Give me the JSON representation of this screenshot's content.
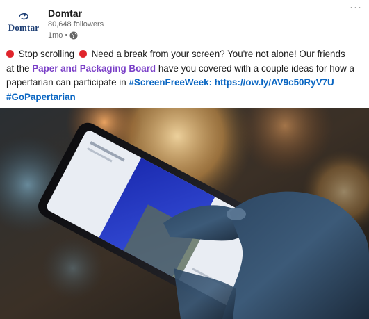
{
  "author": {
    "logo_text": "Domtar",
    "name": "Domtar",
    "followers": "80,648 followers",
    "time": "1mo",
    "separator": "•"
  },
  "menu": {
    "icon": "more-horizontal-icon",
    "glyph": "···"
  },
  "post": {
    "line1": {
      "emoji1": "red-circle",
      "t1": "Stop scrolling",
      "emoji2": "red-circle",
      "t2": "Need a break from your screen? You're not alone! Our friends"
    },
    "line2": {
      "t1": "at the",
      "mention": "Paper and Packaging Board",
      "t2": "have you covered with a couple ideas for how a"
    },
    "line3": {
      "t1": "papertarian can participate in",
      "hashtag": "#ScreenFreeWeek:",
      "link": "https://ow.ly/AV9c50RyV7U"
    },
    "line4": {
      "hashtag": "#GoPapertarian"
    }
  },
  "image": {
    "subject": "hand holding smartphone"
  },
  "colors": {
    "link": "#0a66c2",
    "mention": "#7a3fc7",
    "emoji_red": "#e0242b",
    "logo_blue": "#1c3d73"
  }
}
